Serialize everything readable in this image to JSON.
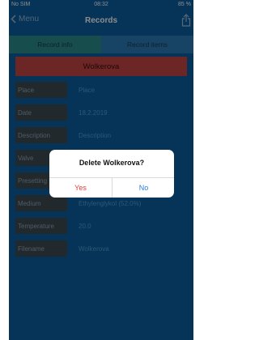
{
  "status_bar": {
    "carrier": "No SIM",
    "time": "08:32",
    "battery": "85 %"
  },
  "nav": {
    "back_label": "Menu",
    "title": "Records"
  },
  "tabs": [
    {
      "label": "Record info"
    },
    {
      "label": "Record items"
    }
  ],
  "record": {
    "name": "Wolkerova"
  },
  "fields": [
    {
      "label": "Place",
      "value": "Place"
    },
    {
      "label": "Date",
      "value": "18.2.2019"
    },
    {
      "label": "Description",
      "value": "Description"
    },
    {
      "label": "Valve",
      "value": ""
    },
    {
      "label": "Presetting",
      "value": ""
    },
    {
      "label": "Medium",
      "value": "Ethylenglykol (52.0%)"
    },
    {
      "label": "Temperature",
      "value": "20.0"
    },
    {
      "label": "Filename",
      "value": "Wolkerova"
    }
  ],
  "dialog": {
    "title": "Delete Wolkerova?",
    "yes_label": "Yes",
    "no_label": "No"
  },
  "colors": {
    "accent": "#0b5fa2",
    "active_tab": "#2a8d8a",
    "header": "#c64545",
    "destructive": "#e53f3f",
    "link": "#2a7bd9"
  }
}
